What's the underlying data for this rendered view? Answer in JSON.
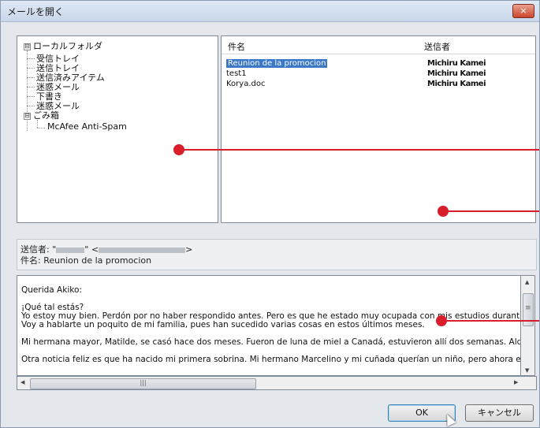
{
  "window": {
    "title": "メールを開く",
    "close_label": "×"
  },
  "folder_tree": {
    "root": {
      "expander": "⊟",
      "label": "ローカルフォルダ"
    },
    "items": [
      {
        "label": "受信トレイ"
      },
      {
        "label": "送信トレイ"
      },
      {
        "label": "送信済みアイテム"
      },
      {
        "label": "迷惑メール"
      },
      {
        "label": "下書き"
      },
      {
        "label": "迷惑メール"
      }
    ],
    "trash": {
      "expander": "⊟",
      "label": "ごみ箱"
    },
    "trash_child": {
      "label": "McAfee Anti-Spam"
    }
  },
  "mail_list": {
    "columns": {
      "subject": "件名",
      "sender": "送信者"
    },
    "rows": [
      {
        "subject": "Reunion de la promocion",
        "sender": "Michiru Kamei",
        "selected": true
      },
      {
        "subject": "test1",
        "sender": "Michiru Kamei",
        "selected": false
      },
      {
        "subject": "Korya.doc",
        "sender": "Michiru Kamei",
        "selected": false
      }
    ]
  },
  "preview_header": {
    "from_label": "送信者:",
    "from_name_prefix": "\"",
    "from_name_suffix": "\" <",
    "from_email_suffix": ">",
    "subject_label": "件名:",
    "subject_value": "Reunion de la promocion"
  },
  "preview_body": {
    "lines": [
      "Querida Akiko:",
      "¡Qué tal estás?",
      "Yo estoy muy bien.  Perdón por no haber respondido antes.  Pero es que he estado muy ocupada con mis estudios durante l",
      "Voy a hablarte un poquito de mi familia, pues han sucedido varias cosas en estos últimos meses.",
      "Mi hermana mayor, Matilde, se casó hace dos meses.  Fueron de luna de miel a Canadá, estuvieron allí dos semanas.  Alqui",
      "Otra noticia feliz es que ha nacido mi primera sobrina.  Mi hermano Marcelino y mi cuñada querían un niño, pero ahora estár"
    ]
  },
  "scrollbars": {
    "v_up": "▲",
    "v_down": "▼",
    "v_grip": "≡",
    "h_left": "◀",
    "h_right": "▶",
    "h_grip": "|||"
  },
  "buttons": {
    "ok": "OK",
    "cancel": "キャンセル"
  },
  "colors": {
    "accent": "#3b78c8",
    "marker": "#d81e2a"
  }
}
